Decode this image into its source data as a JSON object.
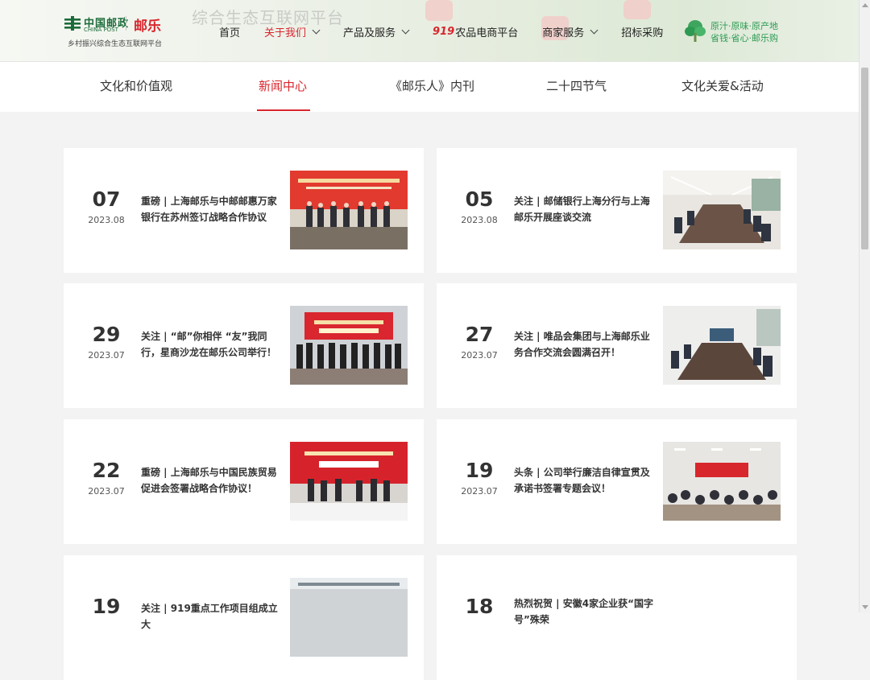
{
  "header": {
    "logo": {
      "china_post_cn": "中国邮政",
      "china_post_en": "CHINA POST",
      "brand": "邮乐",
      "subtitle": "乡村振兴综合生态互联网平台"
    },
    "background_banner_text": "综合生态互联网平台",
    "nav": [
      {
        "label": "首页",
        "has_dropdown": false,
        "active": false
      },
      {
        "label": "关于我们",
        "has_dropdown": true,
        "active": true
      },
      {
        "label": "产品及服务",
        "has_dropdown": true,
        "active": false
      },
      {
        "prefix": "919",
        "label": "农品电商平台",
        "has_dropdown": false,
        "active": false
      },
      {
        "label": "商家服务",
        "has_dropdown": true,
        "active": false
      },
      {
        "label": "招标采购",
        "has_dropdown": false,
        "active": false
      }
    ],
    "slogan": {
      "line1": "原汁·原味·原产地",
      "line2": "省钱·省心·邮乐购"
    }
  },
  "subnav": {
    "tabs": [
      "文化和价值观",
      "新闻中心",
      "《邮乐人》内刊",
      "二十四节气",
      "文化关爱&活动"
    ],
    "active_index": 1
  },
  "news": [
    {
      "day": "07",
      "ym": "2023.08",
      "title": "重磅 | 上海邮乐与中邮邮惠万家银行在苏州签订战略合作协议",
      "image": "signing-ceremony-banner"
    },
    {
      "day": "05",
      "ym": "2023.08",
      "title": "关注 | 邮储银行上海分行与上海邮乐开展座谈交流",
      "image": "meeting-room"
    },
    {
      "day": "29",
      "ym": "2023.07",
      "title": "关注 | “邮”你相伴 “友”我同行，星商沙龙在邮乐公司举行！",
      "image": "group-photo-salon"
    },
    {
      "day": "27",
      "ym": "2023.07",
      "title": "关注 | 唯品会集团与上海邮乐业务合作交流会圆满召开！",
      "image": "meeting-room"
    },
    {
      "day": "22",
      "ym": "2023.07",
      "title": "重磅 | 上海邮乐与中国民族贸易促进会签署战略合作协议！",
      "image": "strategic-signing"
    },
    {
      "day": "19",
      "ym": "2023.07",
      "title": "头条 | 公司举行廉洁自律宣贯及承诺书签署专题会议！",
      "image": "conference-hall"
    },
    {
      "day": "19",
      "ym": "",
      "title": "关注 | 919重点工作项目组成立大",
      "image": "office-photo"
    },
    {
      "day": "18",
      "ym": "",
      "title": "热烈祝贺 | 安徽4家企业获“国字号”殊荣",
      "image": "none"
    }
  ],
  "colors": {
    "accent": "#d8262d",
    "brand_green": "#1b6b3a",
    "slogan_green": "#2d9a53",
    "page_bg": "#f3f3f4"
  }
}
